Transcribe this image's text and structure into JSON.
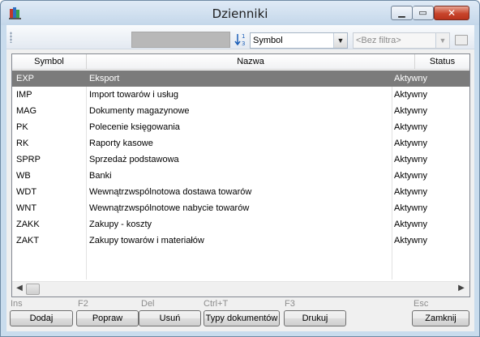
{
  "window": {
    "title": "Dzienniki"
  },
  "toolbar": {
    "sort_combo": {
      "value": "Symbol"
    },
    "filter_combo": {
      "value": "<Bez filtra>"
    }
  },
  "grid": {
    "columns": [
      "Symbol",
      "Nazwa",
      "Status"
    ],
    "rows": [
      {
        "symbol": "EXP",
        "nazwa": "Eksport",
        "status": "Aktywny",
        "selected": true
      },
      {
        "symbol": "IMP",
        "nazwa": "Import towarów i usług",
        "status": "Aktywny"
      },
      {
        "symbol": "MAG",
        "nazwa": "Dokumenty magazynowe",
        "status": "Aktywny"
      },
      {
        "symbol": "PK",
        "nazwa": "Polecenie księgowania",
        "status": "Aktywny"
      },
      {
        "symbol": "RK",
        "nazwa": "Raporty kasowe",
        "status": "Aktywny"
      },
      {
        "symbol": "SPRP",
        "nazwa": "Sprzedaż podstawowa",
        "status": "Aktywny"
      },
      {
        "symbol": "WB",
        "nazwa": "Banki",
        "status": "Aktywny"
      },
      {
        "symbol": "WDT",
        "nazwa": "Wewnątrzwspólnotowa dostawa towarów",
        "status": "Aktywny"
      },
      {
        "symbol": "WNT",
        "nazwa": "Wewnątrzwspólnotowe nabycie towarów",
        "status": "Aktywny"
      },
      {
        "symbol": "ZAKK",
        "nazwa": "Zakupy - koszty",
        "status": "Aktywny"
      },
      {
        "symbol": "ZAKT",
        "nazwa": "Zakupy towarów i materiałów",
        "status": "Aktywny"
      }
    ]
  },
  "shortcuts": {
    "ins": "Ins",
    "f2": "F2",
    "del": "Del",
    "ctrlt": "Ctrl+T",
    "f3": "F3",
    "esc": "Esc"
  },
  "buttons": {
    "dodaj": "Dodaj",
    "popraw": "Popraw",
    "usun": "Usuń",
    "typy": "Typy dokumentów",
    "drukuj": "Drukuj",
    "zamknij": "Zamknij"
  },
  "colors": {
    "selected_row": "#7b7b7b",
    "title_bar": "#c4d7ea",
    "close_button": "#c8452c"
  }
}
